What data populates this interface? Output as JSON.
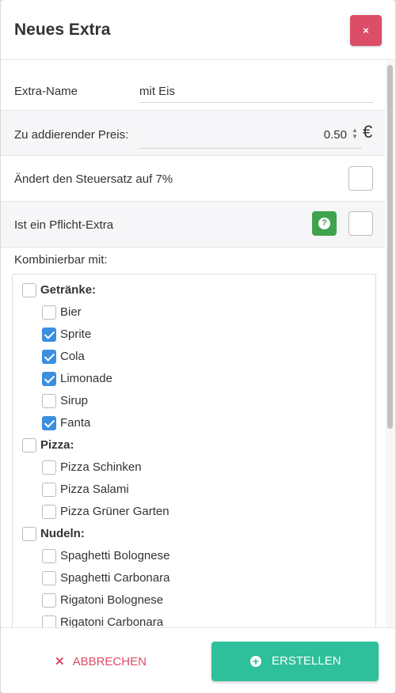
{
  "header": {
    "title": "Neues Extra",
    "close_label": "×"
  },
  "fields": {
    "name_label": "Extra-Name",
    "name_value": "mit Eis",
    "price_label": "Zu addierender Preis:",
    "price_value": "0.50",
    "currency": "€",
    "tax_label": "Ändert den Steuersatz auf 7%",
    "mandatory_label": "Ist ein Pflicht-Extra",
    "help_icon": "?",
    "combinable_label": "Kombinierbar mit:"
  },
  "groups": [
    {
      "name": "Getränke:",
      "checked": false,
      "items": [
        {
          "label": "Bier",
          "checked": false
        },
        {
          "label": "Sprite",
          "checked": true
        },
        {
          "label": "Cola",
          "checked": true
        },
        {
          "label": "Limonade",
          "checked": true
        },
        {
          "label": "Sirup",
          "checked": false
        },
        {
          "label": "Fanta",
          "checked": true
        }
      ]
    },
    {
      "name": "Pizza:",
      "checked": false,
      "items": [
        {
          "label": "Pizza Schinken",
          "checked": false
        },
        {
          "label": "Pizza Salami",
          "checked": false
        },
        {
          "label": "Pizza Grüner Garten",
          "checked": false
        }
      ]
    },
    {
      "name": "Nudeln:",
      "checked": false,
      "items": [
        {
          "label": "Spaghetti Bolognese",
          "checked": false
        },
        {
          "label": "Spaghetti Carbonara",
          "checked": false
        },
        {
          "label": "Rigatoni Bolognese",
          "checked": false
        },
        {
          "label": "Rigatoni Carbonara",
          "checked": false
        }
      ]
    }
  ],
  "footer": {
    "cancel_label": "ABBRECHEN",
    "create_label": "ERSTELLEN"
  },
  "colors": {
    "danger": "#dc4d67",
    "success": "#2ebf9b",
    "help": "#3fa34d",
    "checkbox": "#3c8fe0"
  }
}
